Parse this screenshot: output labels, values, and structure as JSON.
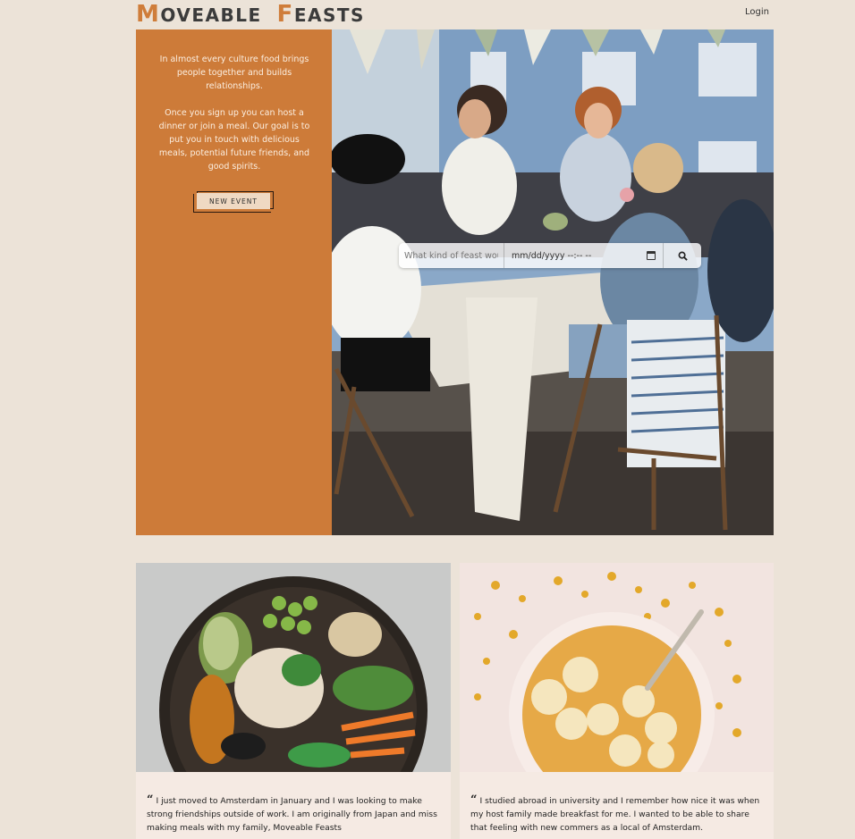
{
  "brand": {
    "cap1": "M",
    "rest1": "OVEABLE",
    "cap2": "F",
    "rest2": "EASTS"
  },
  "nav": {
    "login": "Login"
  },
  "hero": {
    "intro": "In almost every culture food brings people together and builds relationships.",
    "body": "Once you sign up you can host a dinner or join a meal. Our goal is to put you in touch with delicious meals, potential future friends, and good spirits.",
    "new_event": "NEW EVENT"
  },
  "search": {
    "placeholder": "What kind of feast would you like?",
    "date_placeholder": "mm/dd/yyyy --:-- --"
  },
  "testimonials": [
    {
      "text": "I just moved to Amsterdam in January and I was looking to make strong friendships outside of work. I am originally from Japan and miss making meals with my family, Moveable Feasts"
    },
    {
      "text": "I studied abroad in university and I remember how nice it was when my host family made breakfast for me. I wanted to be able to share that feeling with new commers as a local of Amsterdam."
    }
  ],
  "colors": {
    "background": "#ece3d8",
    "accent": "#cd7b39",
    "logo_accent": "#cf7d3a"
  },
  "icons": {
    "calendar": "calendar-icon",
    "search": "search-icon",
    "quote": "quote-icon"
  }
}
